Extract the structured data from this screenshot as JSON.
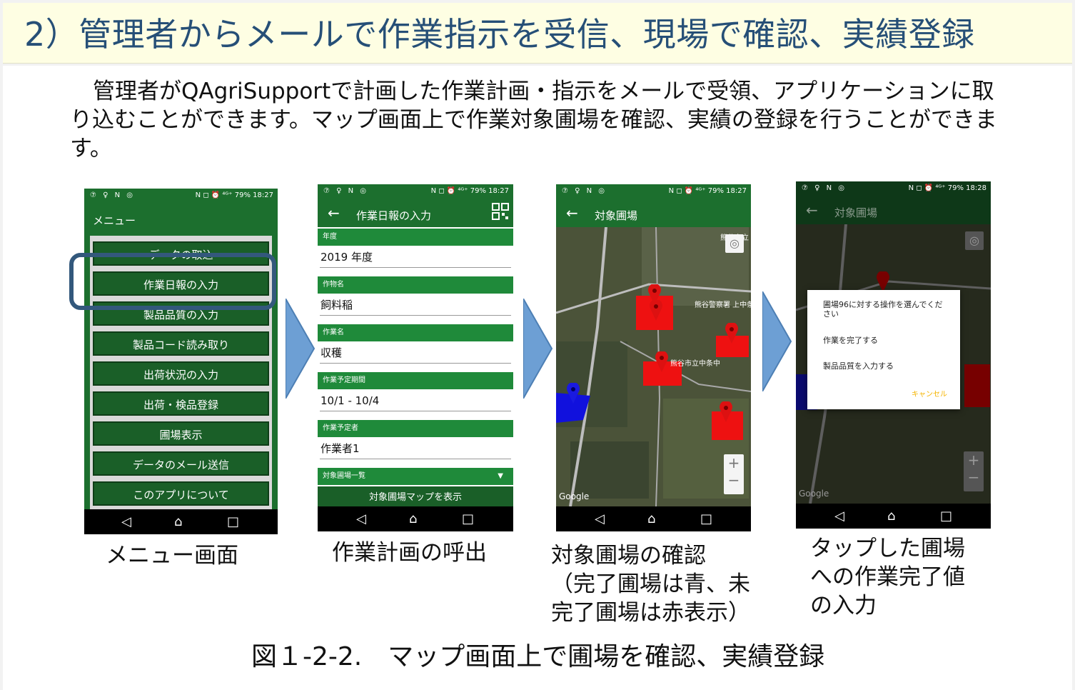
{
  "header": {
    "title": "2）管理者からメールで作業指示を受信、現場で確認、実績登録"
  },
  "intro": "管理者がQAgriSupportで計画した作業計画・指示をメールで受領、アプリケーションに取り込むことができます。マップ画面上で作業対象圃場を確認、実績の登録を行うことができます。",
  "screens": [
    {
      "status_left": "⑦ ♀ N ◎",
      "status_right": "N ◻ ⏰ ⁴ᴳ⁺ 79% 18:27",
      "title": "メニュー",
      "buttons": [
        "データの取込",
        "作業日報の入力",
        "製品品質の入力",
        "製品コード読み取り",
        "出荷状況の入力",
        "出荷・検品登録",
        "圃場表示",
        "データのメール送信",
        "このアプリについて"
      ],
      "caption": "メニュー画面"
    },
    {
      "status_left": "⑦ ♀ N ◎",
      "status_right": "N ◻ ⏰ ⁴ᴳ⁺ 79% 18:27",
      "title": "作業日報の入力",
      "fields": [
        {
          "label": "年度",
          "value": "2019 年度"
        },
        {
          "label": "作物名",
          "value": "飼料稲"
        },
        {
          "label": "作業名",
          "value": "収穫"
        },
        {
          "label": "作業予定期間",
          "value": "10/1 - 10/4"
        },
        {
          "label": "作業予定者",
          "value": "作業者1"
        }
      ],
      "list_label": "対象圃場一覧",
      "map_button": "対象圃場マップを表示",
      "caption": "作業計画の呼出"
    },
    {
      "status_left": "⑦ ♀ N ◎",
      "status_right": "N ◻ ⏰ ⁴ᴳ⁺ 79% 18:27",
      "title": "対象圃場",
      "map_labels": [
        "熊谷警察署 上中条駐在所",
        "熊谷市立中条中",
        "熊谷市立"
      ],
      "google": "Google",
      "caption_lines": [
        "対象圃場の確認",
        "（完了圃場は青、未",
        "完了圃場は赤表示）"
      ]
    },
    {
      "status_left": "⑦ ♀ N ◎",
      "status_right": "N ◻ ⏰ ⁴ᴳ⁺ 79% 18:28",
      "title": "対象圃場",
      "dialog": {
        "message": "圃場96に対する操作を選んでください",
        "option1": "作業を完了する",
        "option2": "製品品質を入力する",
        "cancel": "キャンセル"
      },
      "google": "Google",
      "caption_lines": [
        "タップした圃場",
        "への作業完了値",
        "の入力"
      ]
    }
  ],
  "nav_icons": [
    "back-triangle",
    "home",
    "recents"
  ],
  "figure_caption": "図１-2-2.　マップ画面上で圃場を確認、実績登録",
  "colors": {
    "title_text": "#264f77",
    "title_bg": "#fefee3",
    "app_green": "#1c6f2e",
    "highlight": "#33587c",
    "arrow": "#6d9fd4",
    "field_red": "#ee1111",
    "field_blue": "#1111dd"
  }
}
